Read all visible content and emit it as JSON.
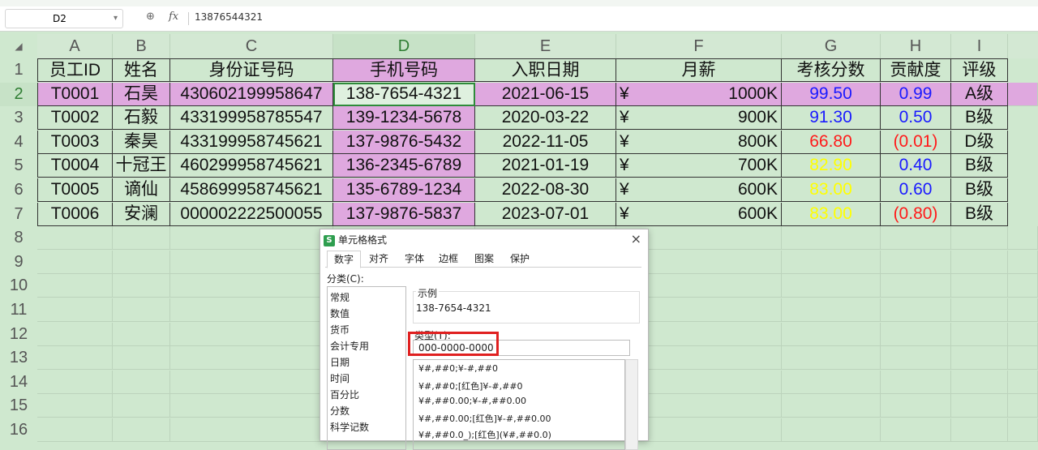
{
  "formula_bar": {
    "name_box": "D2",
    "fx": "fx",
    "content": "13876544321"
  },
  "columns": [
    "A",
    "B",
    "C",
    "D",
    "E",
    "F",
    "G",
    "H",
    "I"
  ],
  "rows": [
    "1",
    "2",
    "3",
    "4",
    "5",
    "6",
    "7",
    "8",
    "9",
    "10",
    "11",
    "12",
    "13",
    "14",
    "15",
    "16"
  ],
  "table": {
    "headers": [
      "员工ID",
      "姓名",
      "身份证号码",
      "手机号码",
      "入职日期",
      "月薪",
      "考核分数",
      "贡献度",
      "评级"
    ],
    "records": [
      {
        "id": "T0001",
        "name": "石昊",
        "idcard": "430602199958647",
        "phone": "138-7654-4321",
        "date": "2021-06-15",
        "cur": "¥",
        "salary": "1000K",
        "score": "99.50",
        "contrib": "0.99",
        "grade": "A级"
      },
      {
        "id": "T0002",
        "name": "石毅",
        "idcard": "433199958785547",
        "phone": "139-1234-5678",
        "date": "2020-03-22",
        "cur": "¥",
        "salary": "900K",
        "score": "91.30",
        "contrib": "0.50",
        "grade": "B级"
      },
      {
        "id": "T0003",
        "name": "秦昊",
        "idcard": "433199958745621",
        "phone": "137-9876-5432",
        "date": "2022-11-05",
        "cur": "¥",
        "salary": "800K",
        "score": "66.80",
        "contrib": "(0.01)",
        "grade": "D级"
      },
      {
        "id": "T0004",
        "name": "十冠王",
        "idcard": "460299958745621",
        "phone": "136-2345-6789",
        "date": "2021-01-19",
        "cur": "¥",
        "salary": "700K",
        "score": "82.90",
        "contrib": "0.40",
        "grade": "B级"
      },
      {
        "id": "T0005",
        "name": "谪仙",
        "idcard": "458699958745621",
        "phone": "135-6789-1234",
        "date": "2022-08-30",
        "cur": "¥",
        "salary": "600K",
        "score": "83.00",
        "contrib": "0.60",
        "grade": "B级"
      },
      {
        "id": "T0006",
        "name": "安澜",
        "idcard": "000002222500055",
        "phone": "137-9876-5837",
        "date": "2023-07-01",
        "cur": "¥",
        "salary": "600K",
        "score": "83.00",
        "contrib": "(0.80)",
        "grade": "B级"
      }
    ]
  },
  "score_colors": [
    "#1a1aff",
    "#1a1aff",
    "#ff1a1a",
    "#ffff00",
    "#ffff00",
    "#ffff00"
  ],
  "contrib_colors": [
    "#1a1aff",
    "#1a1aff",
    "#ff1a1a",
    "#1a1aff",
    "#1a1aff",
    "#ff1a1a"
  ],
  "colors": {
    "row_highlight": "#dfa8df",
    "table_bg": "#cfe8cf",
    "phone_col": "#dfa8df"
  },
  "dialog": {
    "logo": "S",
    "title": "单元格格式",
    "close": "×",
    "tabs": [
      "数字",
      "对齐",
      "字体",
      "边框",
      "图案",
      "保护"
    ],
    "category_label": "分类(C):",
    "categories": [
      "常规",
      "数值",
      "货币",
      "会计专用",
      "日期",
      "时间",
      "百分比",
      "分数",
      "科学记数"
    ],
    "sample_title": "示例",
    "sample_value": "138-7654-4321",
    "type_label": "类型(T):",
    "type_value": "000-0000-0000",
    "formats": [
      "¥#,##0;¥-#,##0",
      "¥#,##0;[红色]¥-#,##0",
      "¥#,##0.00;¥-#,##0.00",
      "¥#,##0.00;[红色]¥-#,##0.00",
      "¥#,##0.0_);[红色](¥#,##0.0)"
    ]
  }
}
